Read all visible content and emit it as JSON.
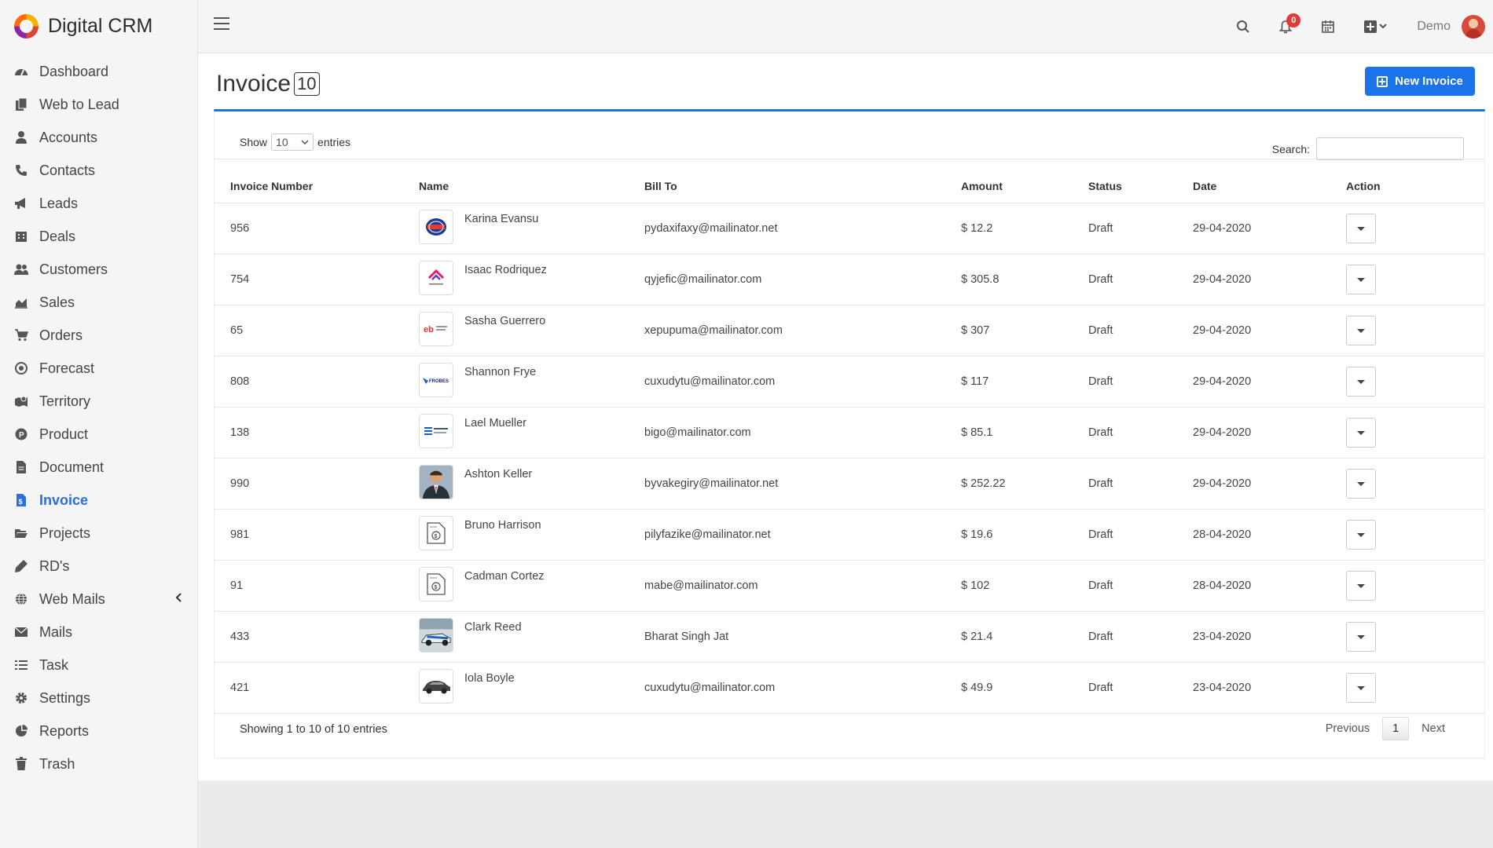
{
  "app": {
    "name": "Digital CRM"
  },
  "sidebar": {
    "items": [
      {
        "label": "Dashboard",
        "icon": "dashboard-icon"
      },
      {
        "label": "Web to Lead",
        "icon": "copy-icon"
      },
      {
        "label": "Accounts",
        "icon": "user-icon"
      },
      {
        "label": "Contacts",
        "icon": "phone-icon"
      },
      {
        "label": "Leads",
        "icon": "bullhorn-icon"
      },
      {
        "label": "Deals",
        "icon": "building-icon"
      },
      {
        "label": "Customers",
        "icon": "users-icon"
      },
      {
        "label": "Sales",
        "icon": "area-chart-icon"
      },
      {
        "label": "Orders",
        "icon": "cart-icon"
      },
      {
        "label": "Forecast",
        "icon": "target-icon"
      },
      {
        "label": "Territory",
        "icon": "map-marker-icon"
      },
      {
        "label": "Product",
        "icon": "product-icon"
      },
      {
        "label": "Document",
        "icon": "document-icon"
      },
      {
        "label": "Invoice",
        "icon": "invoice-icon"
      },
      {
        "label": "Projects",
        "icon": "folder-open-icon"
      },
      {
        "label": "RD's",
        "icon": "pen-icon"
      },
      {
        "label": "Web Mails",
        "icon": "globe-icon"
      },
      {
        "label": "Mails",
        "icon": "envelope-icon"
      },
      {
        "label": "Task",
        "icon": "tasks-icon"
      },
      {
        "label": "Settings",
        "icon": "gear-icon"
      },
      {
        "label": "Reports",
        "icon": "pie-chart-icon"
      },
      {
        "label": "Trash",
        "icon": "trash-icon"
      }
    ],
    "active": "Invoice"
  },
  "topbar": {
    "notification_count": "0",
    "user_name": "Demo"
  },
  "page": {
    "title": "Invoice",
    "count": "10",
    "new_button": "New Invoice"
  },
  "controls": {
    "show_label": "Show",
    "entries_value": "10",
    "entries_label": "entries",
    "search_label": "Search:"
  },
  "table": {
    "columns": [
      "Invoice Number",
      "Name",
      "Bill To",
      "Amount",
      "Status",
      "Date",
      "Action"
    ],
    "rows": [
      {
        "number": "956",
        "name": "Karina Evansu",
        "bill_to": "pydaxifaxy@mailinator.net",
        "amount": "$ 12.2",
        "status": "Draft",
        "date": "29-04-2020",
        "logo": "badge-logo"
      },
      {
        "number": "754",
        "name": "Isaac Rodriquez",
        "bill_to": "qyjefic@mailinator.com",
        "amount": "$ 305.8",
        "status": "Draft",
        "date": "29-04-2020",
        "logo": "house-logo"
      },
      {
        "number": "65",
        "name": "Sasha Guerrero",
        "bill_to": "xepupuma@mailinator.com",
        "amount": "$ 307",
        "status": "Draft",
        "date": "29-04-2020",
        "logo": "eb-logo"
      },
      {
        "number": "808",
        "name": "Shannon Frye",
        "bill_to": "cuxudytu@mailinator.com",
        "amount": "$ 117",
        "status": "Draft",
        "date": "29-04-2020",
        "logo": "frobes-logo"
      },
      {
        "number": "138",
        "name": "Lael Mueller",
        "bill_to": "bigo@mailinator.com",
        "amount": "$ 85.1",
        "status": "Draft",
        "date": "29-04-2020",
        "logo": "stripes-logo"
      },
      {
        "number": "990",
        "name": "Ashton Keller",
        "bill_to": "byvakegiry@mailinator.net",
        "amount": "$ 252.22",
        "status": "Draft",
        "date": "29-04-2020",
        "logo": "photo-logo"
      },
      {
        "number": "981",
        "name": "Bruno Harrison",
        "bill_to": "pilyfazike@mailinator.net",
        "amount": "$ 19.6",
        "status": "Draft",
        "date": "28-04-2020",
        "logo": "invoice-doc-logo"
      },
      {
        "number": "91",
        "name": "Cadman Cortez",
        "bill_to": "mabe@mailinator.com",
        "amount": "$ 102",
        "status": "Draft",
        "date": "28-04-2020",
        "logo": "invoice-doc-logo"
      },
      {
        "number": "433",
        "name": "Clark Reed",
        "bill_to": "Bharat Singh Jat",
        "amount": "$ 21.4",
        "status": "Draft",
        "date": "23-04-2020",
        "logo": "race-car-logo"
      },
      {
        "number": "421",
        "name": "Iola Boyle",
        "bill_to": "cuxudytu@mailinator.com",
        "amount": "$ 49.9",
        "status": "Draft",
        "date": "23-04-2020",
        "logo": "car-logo"
      }
    ]
  },
  "footer": {
    "info": "Showing 1 to 10 of 10 entries",
    "previous": "Previous",
    "page": "1",
    "next": "Next"
  },
  "colors": {
    "accent": "#1a73e8",
    "active_nav": "#2a6ee6",
    "badge": "#e53935"
  }
}
